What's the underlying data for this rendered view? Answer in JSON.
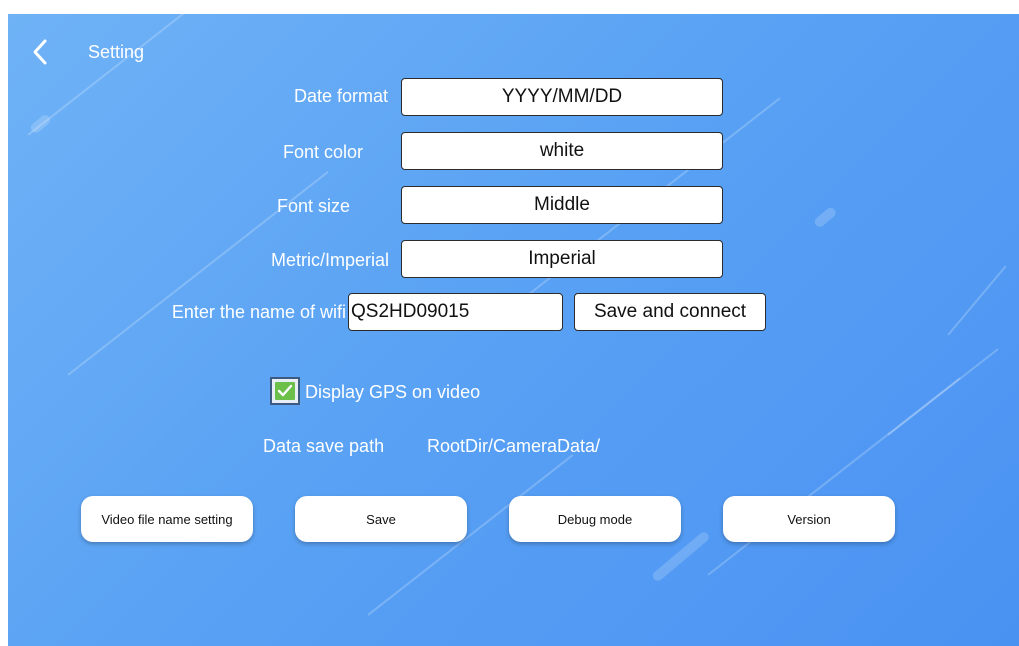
{
  "header": {
    "title": "Setting",
    "back_icon": "chevron-left-icon"
  },
  "settings": {
    "date_format": {
      "label": "Date format",
      "value": "YYYY/MM/DD"
    },
    "font_color": {
      "label": "Font color",
      "value": "white"
    },
    "font_size": {
      "label": "Font size",
      "value": "Middle"
    },
    "units": {
      "label": "Metric/Imperial",
      "value": "Imperial"
    }
  },
  "wifi": {
    "label": "Enter the name of wifi",
    "value": "QS2HD09015",
    "connect_label": "Save and connect"
  },
  "gps": {
    "label": "Display GPS on video",
    "checked": true
  },
  "save_path": {
    "label": "Data save path",
    "value": "RootDir/CameraData/"
  },
  "buttons": {
    "video_file_name": "Video file name setting",
    "save": "Save",
    "debug": "Debug mode",
    "version": "Version"
  },
  "colors": {
    "background": "#5aa2f4",
    "check_green": "#6cc04a"
  }
}
